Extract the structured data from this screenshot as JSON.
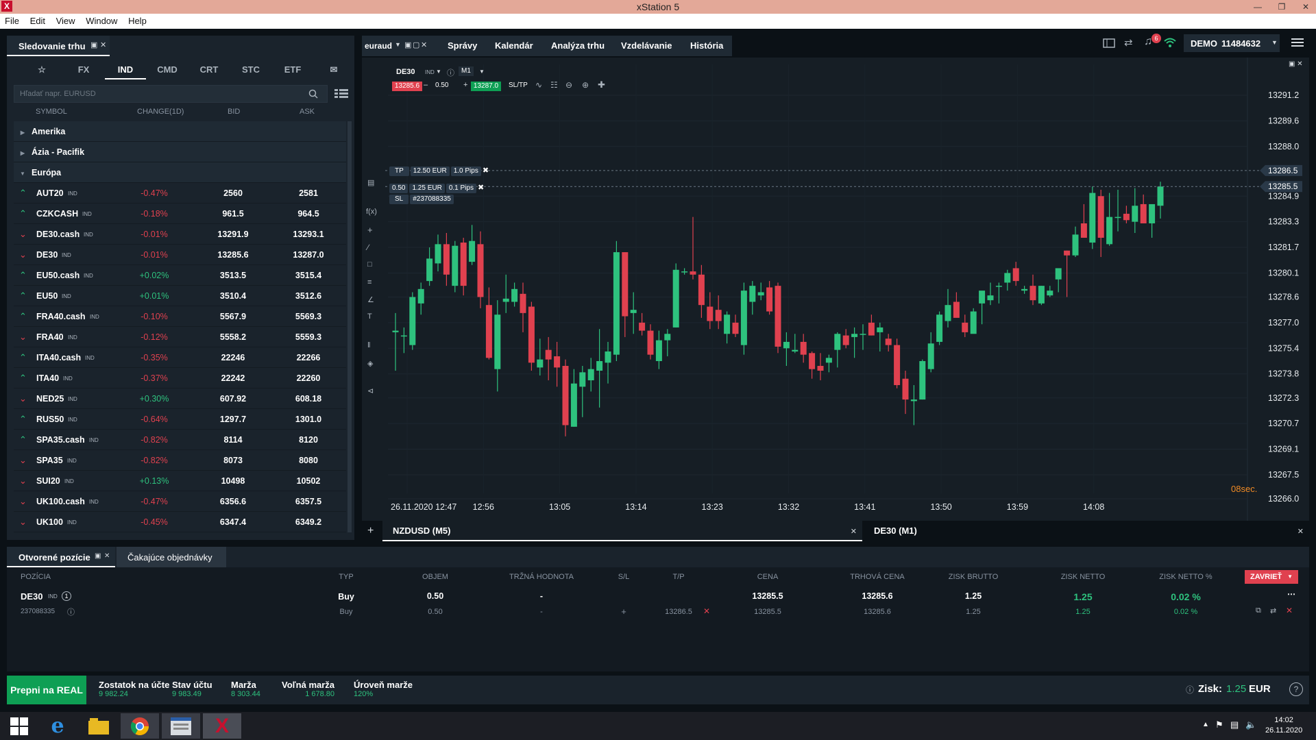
{
  "window": {
    "title": "xStation 5",
    "logo": "X"
  },
  "menu": [
    "File",
    "Edit",
    "View",
    "Window",
    "Help"
  ],
  "watch": {
    "title": "Sledovanie trhu",
    "tabs": [
      "FX",
      "IND",
      "CMD",
      "CRT",
      "STC",
      "ETF"
    ],
    "active": "IND",
    "search_placeholder": "Hľadať napr. EURUSD",
    "columns": [
      "SYMBOL",
      "CHANGE(1D)",
      "BID",
      "ASK"
    ],
    "groups": [
      "Amerika",
      "Ázia - Pacifik",
      "Európa"
    ],
    "rows": [
      {
        "dir": "up",
        "symbol": "AUT20",
        "change": "-0.47%",
        "bid": "2560",
        "ask": "2581"
      },
      {
        "dir": "up",
        "symbol": "CZKCASH",
        "change": "-0.18%",
        "bid": "961.5",
        "ask": "964.5"
      },
      {
        "dir": "down",
        "symbol": "DE30.cash",
        "change": "-0.01%",
        "bid": "13291.9",
        "ask": "13293.1"
      },
      {
        "dir": "down",
        "symbol": "DE30",
        "change": "-0.01%",
        "bid": "13285.6",
        "ask": "13287.0"
      },
      {
        "dir": "up",
        "symbol": "EU50.cash",
        "change": "+0.02%",
        "bid": "3513.5",
        "ask": "3515.4"
      },
      {
        "dir": "up",
        "symbol": "EU50",
        "change": "+0.01%",
        "bid": "3510.4",
        "ask": "3512.6"
      },
      {
        "dir": "up",
        "symbol": "FRA40.cash",
        "change": "-0.10%",
        "bid": "5567.9",
        "ask": "5569.3"
      },
      {
        "dir": "down",
        "symbol": "FRA40",
        "change": "-0.12%",
        "bid": "5558.2",
        "ask": "5559.3"
      },
      {
        "dir": "up",
        "symbol": "ITA40.cash",
        "change": "-0.35%",
        "bid": "22246",
        "ask": "22266"
      },
      {
        "dir": "up",
        "symbol": "ITA40",
        "change": "-0.37%",
        "bid": "22242",
        "ask": "22260"
      },
      {
        "dir": "down",
        "symbol": "NED25",
        "change": "+0.30%",
        "bid": "607.92",
        "ask": "608.18"
      },
      {
        "dir": "up",
        "symbol": "RUS50",
        "change": "-0.64%",
        "bid": "1297.7",
        "ask": "1301.0"
      },
      {
        "dir": "up",
        "symbol": "SPA35.cash",
        "change": "-0.82%",
        "bid": "8114",
        "ask": "8120"
      },
      {
        "dir": "down",
        "symbol": "SPA35",
        "change": "-0.82%",
        "bid": "8073",
        "ask": "8080"
      },
      {
        "dir": "down",
        "symbol": "SUI20",
        "change": "+0.13%",
        "bid": "10498",
        "ask": "10502"
      },
      {
        "dir": "down",
        "symbol": "UK100.cash",
        "change": "-0.47%",
        "bid": "6356.6",
        "ask": "6357.5"
      },
      {
        "dir": "down",
        "symbol": "UK100",
        "change": "-0.45%",
        "bid": "6347.4",
        "ask": "6349.2"
      }
    ],
    "tag": "IND"
  },
  "topnav": {
    "account": "euraud",
    "tabs": [
      "Správy",
      "Kalendár",
      "Analýza trhu",
      "Vzdelávanie",
      "História"
    ],
    "notif_count": "6",
    "mode": "DEMO",
    "account_no": "11484632"
  },
  "chart": {
    "symbol": "DE30",
    "tag": "IND",
    "timeframe": "M1",
    "sell": "13285.6",
    "volume": "0.50",
    "buy": "13287.0",
    "sltp": "SL/TP",
    "tp": {
      "label": "TP",
      "amount": "12.50 EUR",
      "pips": "1.0 Pips"
    },
    "pos": {
      "volume": "0.50",
      "amount": "1.25 EUR",
      "pips": "0.1 Pips"
    },
    "sl": {
      "label": "SL",
      "id": "#237088335"
    },
    "tp_price": "13286.5",
    "current_price": "13285.5",
    "countdown": "08sec.",
    "y_ticks": [
      "13291.2",
      "13289.6",
      "13288.0",
      "13284.9",
      "13283.3",
      "13281.7",
      "13280.1",
      "13278.6",
      "13277.0",
      "13275.4",
      "13273.8",
      "13272.3",
      "13270.7",
      "13269.1",
      "13267.5",
      "13266.0"
    ],
    "x_ticks": [
      "26.11.2020 12:47",
      "12:56",
      "13:05",
      "13:14",
      "13:23",
      "13:32",
      "13:41",
      "13:50",
      "13:59",
      "14:08"
    ],
    "candles": [
      [
        13276.4,
        13277.6,
        13274.0,
        13276.5
      ],
      [
        13276.2,
        13276.7,
        13275.1,
        13276.2
      ],
      [
        13275.6,
        13278.9,
        13275.3,
        13278.6
      ],
      [
        13278.2,
        13279.5,
        13277.5,
        13279.1
      ],
      [
        13279.6,
        13281.7,
        13279.3,
        13281.0
      ],
      [
        13280.7,
        13282.5,
        13280.2,
        13281.9
      ],
      [
        13281.9,
        13282.6,
        13279.3,
        13280.0
      ],
      [
        13279.3,
        13282.1,
        13278.9,
        13281.8
      ],
      [
        13282.0,
        13282.3,
        13278.7,
        13279.3
      ],
      [
        13280.8,
        13283.1,
        13280.6,
        13282.1
      ],
      [
        13281.9,
        13282.7,
        13277.9,
        13278.6
      ],
      [
        13278.1,
        13279.2,
        13274.7,
        13274.8
      ],
      [
        13274.1,
        13278.4,
        13272.7,
        13277.5
      ],
      [
        13278.3,
        13280.0,
        13277.6,
        13278.5
      ],
      [
        13278.3,
        13279.5,
        13278.0,
        13279.1
      ],
      [
        13278.8,
        13279.5,
        13276.4,
        13277.6
      ],
      [
        13278.0,
        13278.3,
        13274.0,
        13274.5
      ],
      [
        13274.2,
        13276.0,
        13273.7,
        13274.7
      ],
      [
        13275.3,
        13276.1,
        13273.4,
        13274.7
      ],
      [
        13274.9,
        13275.8,
        13273.0,
        13274.2
      ],
      [
        13274.3,
        13274.7,
        13269.9,
        13270.6
      ],
      [
        13270.5,
        13274.1,
        13270.5,
        13273.2
      ],
      [
        13273.0,
        13274.3,
        13271.1,
        13273.9
      ],
      [
        13273.4,
        13274.8,
        13272.7,
        13274.1
      ],
      [
        13274.0,
        13276.6,
        13271.7,
        13274.6
      ],
      [
        13274.5,
        13275.8,
        13273.2,
        13275.2
      ],
      [
        13275.0,
        13282.1,
        13274.6,
        13281.4
      ],
      [
        13281.4,
        13281.4,
        13276.1,
        13277.4
      ],
      [
        13277.6,
        13278.9,
        13276.3,
        13277.8
      ],
      [
        13277.0,
        13277.6,
        13276.2,
        13276.5
      ],
      [
        13276.5,
        13276.9,
        13274.7,
        13275.0
      ],
      [
        13274.6,
        13276.5,
        13274.1,
        13275.9
      ],
      [
        13275.9,
        13276.6,
        13274.9,
        13276.3
      ],
      [
        13276.7,
        13280.7,
        13276.7,
        13280.3
      ],
      [
        13280.2,
        13280.4,
        13280.0,
        13280.2
      ],
      [
        13280.2,
        13283.6,
        13279.7,
        13280.0
      ],
      [
        13280.0,
        13280.6,
        13277.3,
        13278.1
      ],
      [
        13278.0,
        13278.9,
        13276.6,
        13277.1
      ],
      [
        13277.8,
        13278.7,
        13276.6,
        13277.1
      ],
      [
        13276.3,
        13277.7,
        13275.7,
        13277.5
      ],
      [
        13277.0,
        13277.5,
        13276.1,
        13276.3
      ],
      [
        13275.6,
        13279.5,
        13275.0,
        13279.0
      ],
      [
        13278.3,
        13279.6,
        13277.5,
        13279.3
      ],
      [
        13278.7,
        13279.5,
        13278.4,
        13278.9
      ],
      [
        13279.2,
        13279.6,
        13277.5,
        13277.7
      ],
      [
        13279.3,
        13279.5,
        13275.1,
        13275.5
      ],
      [
        13275.4,
        13276.4,
        13274.3,
        13275.8
      ],
      [
        13275.2,
        13276.3,
        13275.1,
        13275.3
      ],
      [
        13275.8,
        13276.3,
        13274.5,
        13275.0
      ],
      [
        13275.1,
        13275.2,
        13273.5,
        13274.1
      ],
      [
        13274.3,
        13275.1,
        13273.4,
        13274.0
      ],
      [
        13274.5,
        13275.0,
        13273.9,
        13274.8
      ],
      [
        13275.3,
        13276.4,
        13274.2,
        13276.3
      ],
      [
        13276.2,
        13276.6,
        13275.4,
        13275.6
      ],
      [
        13276.1,
        13276.7,
        13274.8,
        13276.3
      ],
      [
        13276.3,
        13276.9,
        13275.3,
        13276.3
      ],
      [
        13277.0,
        13277.5,
        13276.2,
        13276.2
      ],
      [
        13276.4,
        13277.0,
        13275.2,
        13276.7
      ],
      [
        13276.0,
        13276.3,
        13275.2,
        13275.6
      ],
      [
        13275.6,
        13276.0,
        13272.9,
        13273.1
      ],
      [
        13273.5,
        13274.0,
        13271.3,
        13272.2
      ],
      [
        13272.1,
        13273.1,
        13270.6,
        13272.2
      ],
      [
        13272.2,
        13274.7,
        13272.2,
        13274.6
      ],
      [
        13274.1,
        13276.4,
        13273.9,
        13275.7
      ],
      [
        13275.8,
        13277.7,
        13275.6,
        13277.5
      ],
      [
        13277.1,
        13279.1,
        13276.7,
        13278.1
      ],
      [
        13278.3,
        13278.9,
        13277.4,
        13277.3
      ],
      [
        13277.0,
        13277.5,
        13276.1,
        13276.4
      ],
      [
        13276.3,
        13277.9,
        13276.5,
        13277.7
      ],
      [
        13278.2,
        13278.3,
        13276.9,
        13279.0
      ],
      [
        13278.4,
        13279.5,
        13278.1,
        13278.7
      ],
      [
        13279.3,
        13279.5,
        13278.2,
        13279.3
      ],
      [
        13279.5,
        13280.3,
        13279.0,
        13280.1
      ],
      [
        13280.4,
        13280.8,
        13279.3,
        13279.6
      ],
      [
        13279.0,
        13279.3,
        13278.8,
        13279.1
      ],
      [
        13279.3,
        13280.0,
        13278.1,
        13278.4
      ],
      [
        13278.2,
        13279.3,
        13278.1,
        13279.3
      ],
      [
        13278.7,
        13279.3,
        13278.6,
        13279.0
      ],
      [
        13279.7,
        13280.3,
        13278.9,
        13280.4
      ],
      [
        13281.5,
        13281.5,
        13278.6,
        13281.2
      ],
      [
        13281.2,
        13283.0,
        13281.1,
        13282.5
      ],
      [
        13283.2,
        13284.4,
        13282.5,
        13282.3
      ],
      [
        13282.0,
        13285.5,
        13281.6,
        13285.1
      ],
      [
        13284.9,
        13285.3,
        13281.1,
        13282.3
      ],
      [
        13281.9,
        13285.1,
        13281.8,
        13283.6
      ],
      [
        13283.6,
        13285.3,
        13282.7,
        13283.6
      ],
      [
        13283.8,
        13284.3,
        13283.2,
        13283.4
      ],
      [
        13283.3,
        13285.4,
        13282.6,
        13284.3
      ],
      [
        13284.4,
        13285.0,
        13283.2,
        13283.2
      ],
      [
        13283.2,
        13284.1,
        13282.3,
        13284.4
      ],
      [
        13284.3,
        13285.8,
        13283.5,
        13285.5
      ]
    ]
  },
  "chart_tabs": [
    "NZDUSD (M5)",
    "DE30 (M1)"
  ],
  "positions": {
    "tabs": [
      "Otvorené pozície",
      "Čakajúce objednávky"
    ],
    "columns": [
      "POZÍCIA",
      "TYP",
      "OBJEM",
      "TRŽNÁ HODNOTA",
      "S/L",
      "T/P",
      "CENA",
      "TRHOVÁ CENA",
      "ZISK BRUTTO",
      "ZISK NETTO",
      "ZISK NETTO %"
    ],
    "close_btn": "ZAVRIEŤ",
    "main": {
      "symbol": "DE30",
      "tag": "IND",
      "count": "1",
      "type": "Buy",
      "volume": "0.50",
      "market_value": "-",
      "price": "13285.5",
      "market_price": "13285.6",
      "gross": "1.25",
      "net": "1.25",
      "net_pct": "0.02 %"
    },
    "detail": {
      "id": "237088335",
      "type": "Buy",
      "volume": "0.50",
      "market_value": "-",
      "sl": "+",
      "tp": "13286.5",
      "price": "13285.5",
      "market_price": "13285.6",
      "gross": "1.25",
      "net": "1.25",
      "net_pct": "0.02 %"
    }
  },
  "footer": {
    "real_btn": "Prepni na REAL",
    "stats": [
      {
        "label": "Zostatok na účte",
        "value": "9 982.24"
      },
      {
        "label": "Stav účtu",
        "value": "9 983.49"
      },
      {
        "label": "Marža",
        "value": "8 303.44"
      },
      {
        "label": "Voľná marža",
        "value": "1 678.80"
      },
      {
        "label": "Úroveň marže",
        "value": "120%"
      }
    ],
    "profit_label": "Zisk:",
    "profit_value": "1.25",
    "profit_ccy": "EUR"
  },
  "taskbar": {
    "time": "14:02",
    "date": "26.11.2020"
  },
  "colors": {
    "up": "#2ec27e",
    "down": "#e0414f",
    "accent": "#0e9f54"
  }
}
